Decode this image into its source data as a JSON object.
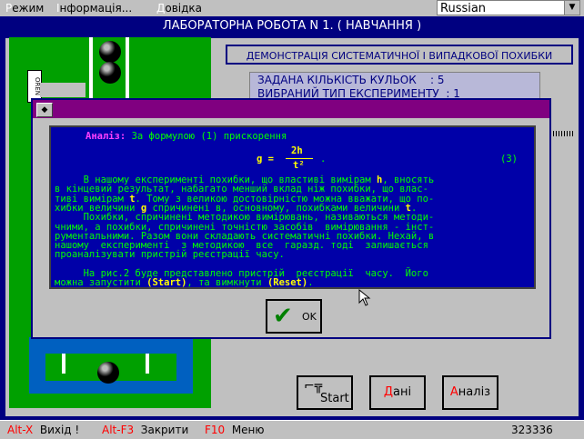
{
  "menu": {
    "items": [
      {
        "hotkey": "Р",
        "rest": "ежим"
      },
      {
        "hotkey": "І",
        "rest": "нформація..."
      },
      {
        "hotkey": "Д",
        "rest": "овідка"
      }
    ],
    "language": "Russian"
  },
  "window": {
    "title": "ЛАБОРАТОРНА РОБОТА N 1. ( НАВЧАННЯ )"
  },
  "scene": {
    "side_label": "OREN"
  },
  "demo": {
    "title": "ДЕМОНСТРАЦІЯ СИСТЕМАТИЧНОЇ І ВИПАДКОВОЇ ПОХИБКИ",
    "lines": [
      {
        "label": "ЗАДАНА КІЛЬКІСТЬ КУЛЬОК",
        "value": ": 5"
      },
      {
        "label": "ВИБРАНИЙ ТИП ЕКСПЕРИМЕНТУ",
        "value": ": 1"
      }
    ]
  },
  "dialog": {
    "analysis_label": "Аналіз:",
    "intro": "За формулою (1) прискорення",
    "formula": {
      "lhs": "g =",
      "numerator": "2h",
      "denominator": "t²",
      "tail": ".",
      "number": "(3)"
    },
    "lines": [
      [
        {
          "t": "     В нашому експерименті похибки, що властиві вимірам "
        },
        {
          "t": "h",
          "c": "y"
        },
        {
          "t": ", вносять"
        }
      ],
      [
        {
          "t": "в кінцевий результат, набагато менший вклад ніж похибки, що влас-"
        }
      ],
      [
        {
          "t": "тиві вимірам "
        },
        {
          "t": "t",
          "c": "y"
        },
        {
          "t": ". Тому з великою достовірністю можна вважати, що по-"
        }
      ],
      [
        {
          "t": "хибки величини "
        },
        {
          "t": "g",
          "c": "y"
        },
        {
          "t": " спричинені в, основному, похибками величини "
        },
        {
          "t": "t",
          "c": "y"
        },
        {
          "t": "."
        }
      ],
      [
        {
          "t": "     Похибки, спричинені методикою вимірювань, називаються методи-"
        }
      ],
      [
        {
          "t": "чними, а похибки, спричинені точністю засобів  вимірювання - інст-"
        }
      ],
      [
        {
          "t": "рументальними. Разом вони складають систематичні похибки. Нехай, в"
        }
      ],
      [
        {
          "t": "нашому  експерименті  з методикою  все  гаразд. тоді  залишається"
        }
      ],
      [
        {
          "t": "проаналізувати пристрій реєстрації часу."
        }
      ],
      [
        {
          "t": ""
        }
      ],
      [
        {
          "t": "     На рис.2 буде представлено пристрій  реєстрації  часу.  Його"
        }
      ],
      [
        {
          "t": "можна запустити "
        },
        {
          "t": "(Start)",
          "c": "y"
        },
        {
          "t": ", та вимкнути "
        },
        {
          "t": "(Reset)",
          "c": "y"
        },
        {
          "t": "."
        }
      ]
    ],
    "ok_label": "OK"
  },
  "buttons": {
    "start": "Start",
    "data": {
      "hotkey": "Д",
      "rest": "ані"
    },
    "analysis": {
      "hotkey": "А",
      "rest": "наліз"
    }
  },
  "status": {
    "items": [
      {
        "key": "Alt-X",
        "label": "Вихід !"
      },
      {
        "key": "Alt-F3",
        "label": "Закрити"
      },
      {
        "key": "F10",
        "label": "Меню"
      }
    ],
    "number": "323336"
  }
}
